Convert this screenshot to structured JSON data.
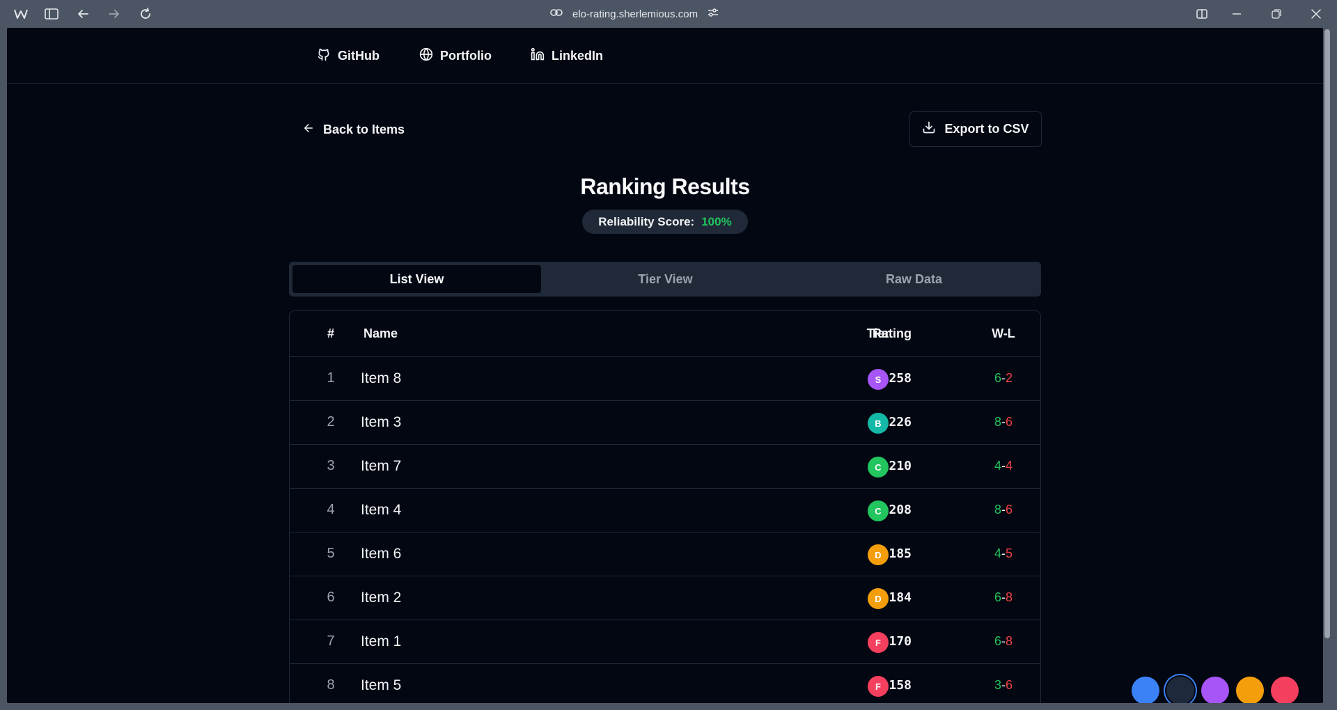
{
  "browser": {
    "url": "elo-rating.sherlemious.com"
  },
  "nav": {
    "links": [
      {
        "label": "GitHub",
        "icon": "github-icon"
      },
      {
        "label": "Portfolio",
        "icon": "globe-icon"
      },
      {
        "label": "LinkedIn",
        "icon": "linkedin-icon"
      }
    ]
  },
  "header": {
    "back_label": "Back to Items",
    "export_label": "Export to CSV",
    "title": "Ranking Results",
    "reliability_label": "Reliability Score:",
    "reliability_value": "100%"
  },
  "tabs": [
    {
      "label": "List View",
      "active": true
    },
    {
      "label": "Tier View",
      "active": false
    },
    {
      "label": "Raw Data",
      "active": false
    }
  ],
  "table": {
    "columns": [
      "#",
      "Name",
      "Rating",
      "Tier",
      "W-L"
    ],
    "rows": [
      {
        "rank": "1",
        "name": "Item 8",
        "rating": "1258",
        "tier": "S",
        "wins": "6",
        "losses": "2"
      },
      {
        "rank": "2",
        "name": "Item 3",
        "rating": "1226",
        "tier": "B",
        "wins": "8",
        "losses": "6"
      },
      {
        "rank": "3",
        "name": "Item 7",
        "rating": "1210",
        "tier": "C",
        "wins": "4",
        "losses": "4"
      },
      {
        "rank": "4",
        "name": "Item 4",
        "rating": "1208",
        "tier": "C",
        "wins": "8",
        "losses": "6"
      },
      {
        "rank": "5",
        "name": "Item 6",
        "rating": "1185",
        "tier": "D",
        "wins": "4",
        "losses": "5"
      },
      {
        "rank": "6",
        "name": "Item 2",
        "rating": "1184",
        "tier": "D",
        "wins": "6",
        "losses": "8"
      },
      {
        "rank": "7",
        "name": "Item 1",
        "rating": "1170",
        "tier": "F",
        "wins": "6",
        "losses": "8"
      },
      {
        "rank": "8",
        "name": "Item 5",
        "rating": "1158",
        "tier": "F",
        "wins": "3",
        "losses": "6"
      }
    ]
  },
  "tier_colors": {
    "S": "#a855f7",
    "B": "#14b8a6",
    "C": "#22c55e",
    "D": "#f59e0b",
    "F": "#f43f5e"
  },
  "theme_swatches": [
    {
      "name": "blue",
      "color": "#3b82f6",
      "selected": false
    },
    {
      "name": "dark",
      "color": "#1e293b",
      "selected": true
    },
    {
      "name": "purple",
      "color": "#a855f7",
      "selected": false
    },
    {
      "name": "amber",
      "color": "#f59e0b",
      "selected": false
    },
    {
      "name": "rose",
      "color": "#f43f5e",
      "selected": false
    }
  ]
}
